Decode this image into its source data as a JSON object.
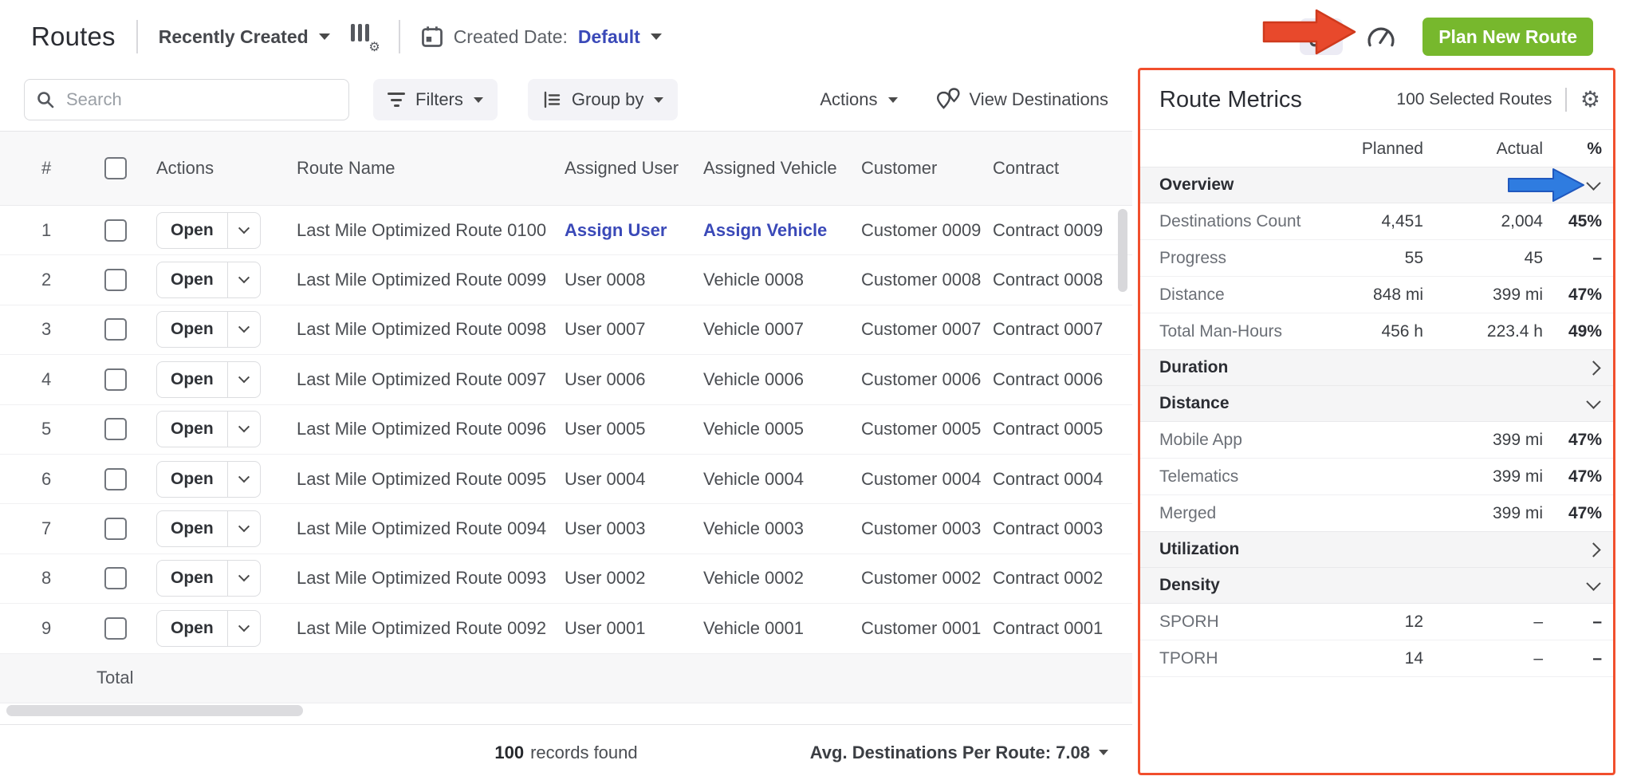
{
  "colors": {
    "accent_green": "#77b82d",
    "panel_border": "#f14f2d",
    "link_blue": "#3a49b8",
    "annotation_red": "#e8492c",
    "annotation_blue": "#2f7ce0"
  },
  "header": {
    "title": "Routes",
    "sort_label": "Recently Created",
    "created_date_label": "Created Date:",
    "created_date_value": "Default",
    "plan_new_route_label": "Plan New Route"
  },
  "toolbar": {
    "search_placeholder": "Search",
    "filters_label": "Filters",
    "group_by_label": "Group by",
    "actions_label": "Actions",
    "view_destinations_label": "View Destinations"
  },
  "table": {
    "columns": {
      "num": "#",
      "actions": "Actions",
      "route": "Route Name",
      "user": "Assigned User",
      "vehicle": "Assigned Vehicle",
      "customer": "Customer",
      "contract": "Contract"
    },
    "open_label": "Open",
    "total_label": "Total",
    "rows": [
      {
        "num": "1",
        "route": "Last Mile Optimized Route 0100",
        "user": "Assign User",
        "user_is_link": true,
        "vehicle": "Assign Vehicle",
        "vehicle_is_link": true,
        "customer": "Customer 0009",
        "contract": "Contract 0009"
      },
      {
        "num": "2",
        "route": "Last Mile Optimized Route 0099",
        "user": "User 0008",
        "vehicle": "Vehicle 0008",
        "customer": "Customer 0008",
        "contract": "Contract 0008"
      },
      {
        "num": "3",
        "route": "Last Mile Optimized Route 0098",
        "user": "User 0007",
        "vehicle": "Vehicle 0007",
        "customer": "Customer 0007",
        "contract": "Contract 0007"
      },
      {
        "num": "4",
        "route": "Last Mile Optimized Route 0097",
        "user": "User 0006",
        "vehicle": "Vehicle 0006",
        "customer": "Customer 0006",
        "contract": "Contract 0006"
      },
      {
        "num": "5",
        "route": "Last Mile Optimized Route 0096",
        "user": "User 0005",
        "vehicle": "Vehicle 0005",
        "customer": "Customer 0005",
        "contract": "Contract 0005"
      },
      {
        "num": "6",
        "route": "Last Mile Optimized Route 0095",
        "user": "User 0004",
        "vehicle": "Vehicle 0004",
        "customer": "Customer 0004",
        "contract": "Contract 0004"
      },
      {
        "num": "7",
        "route": "Last Mile Optimized Route 0094",
        "user": "User 0003",
        "vehicle": "Vehicle 0003",
        "customer": "Customer 0003",
        "contract": "Contract 0003"
      },
      {
        "num": "8",
        "route": "Last Mile Optimized Route 0093",
        "user": "User 0002",
        "vehicle": "Vehicle 0002",
        "customer": "Customer 0002",
        "contract": "Contract 0002"
      },
      {
        "num": "9",
        "route": "Last Mile Optimized Route 0092",
        "user": "User 0001",
        "vehicle": "Vehicle 0001",
        "customer": "Customer 0001",
        "contract": "Contract 0001"
      }
    ]
  },
  "footer": {
    "records_count": "100",
    "records_text": "records found",
    "avg_label": "Avg. Destinations Per Route: 7.08"
  },
  "metrics_panel": {
    "title": "Route Metrics",
    "selected_label": "100 Selected Routes",
    "col_planned": "Planned",
    "col_actual": "Actual",
    "col_pct": "%",
    "rows": [
      {
        "type": "section",
        "label": "Overview",
        "chevron": "down"
      },
      {
        "type": "metric",
        "label": "Destinations Count",
        "planned": "4,451",
        "actual": "2,004",
        "pct": "45%"
      },
      {
        "type": "metric",
        "label": "Progress",
        "planned": "55",
        "actual": "45",
        "pct": "–"
      },
      {
        "type": "metric",
        "label": "Distance",
        "planned": "848 mi",
        "actual": "399 mi",
        "pct": "47%"
      },
      {
        "type": "metric",
        "label": "Total Man-Hours",
        "planned": "456 h",
        "actual": "223.4 h",
        "pct": "49%"
      },
      {
        "type": "section",
        "label": "Duration",
        "chevron": "right"
      },
      {
        "type": "section",
        "label": "Distance",
        "chevron": "down"
      },
      {
        "type": "metric",
        "label": "Mobile App",
        "planned": "",
        "actual": "399 mi",
        "pct": "47%"
      },
      {
        "type": "metric",
        "label": "Telematics",
        "planned": "",
        "actual": "399 mi",
        "pct": "47%"
      },
      {
        "type": "metric",
        "label": "Merged",
        "planned": "",
        "actual": "399 mi",
        "pct": "47%"
      },
      {
        "type": "section",
        "label": "Utilization",
        "chevron": "right"
      },
      {
        "type": "section",
        "label": "Density",
        "chevron": "down"
      },
      {
        "type": "metric",
        "label": "SPORH",
        "planned": "12",
        "actual": "–",
        "pct": "–"
      },
      {
        "type": "metric",
        "label": "TPORH",
        "planned": "14",
        "actual": "–",
        "pct": "–"
      }
    ]
  }
}
